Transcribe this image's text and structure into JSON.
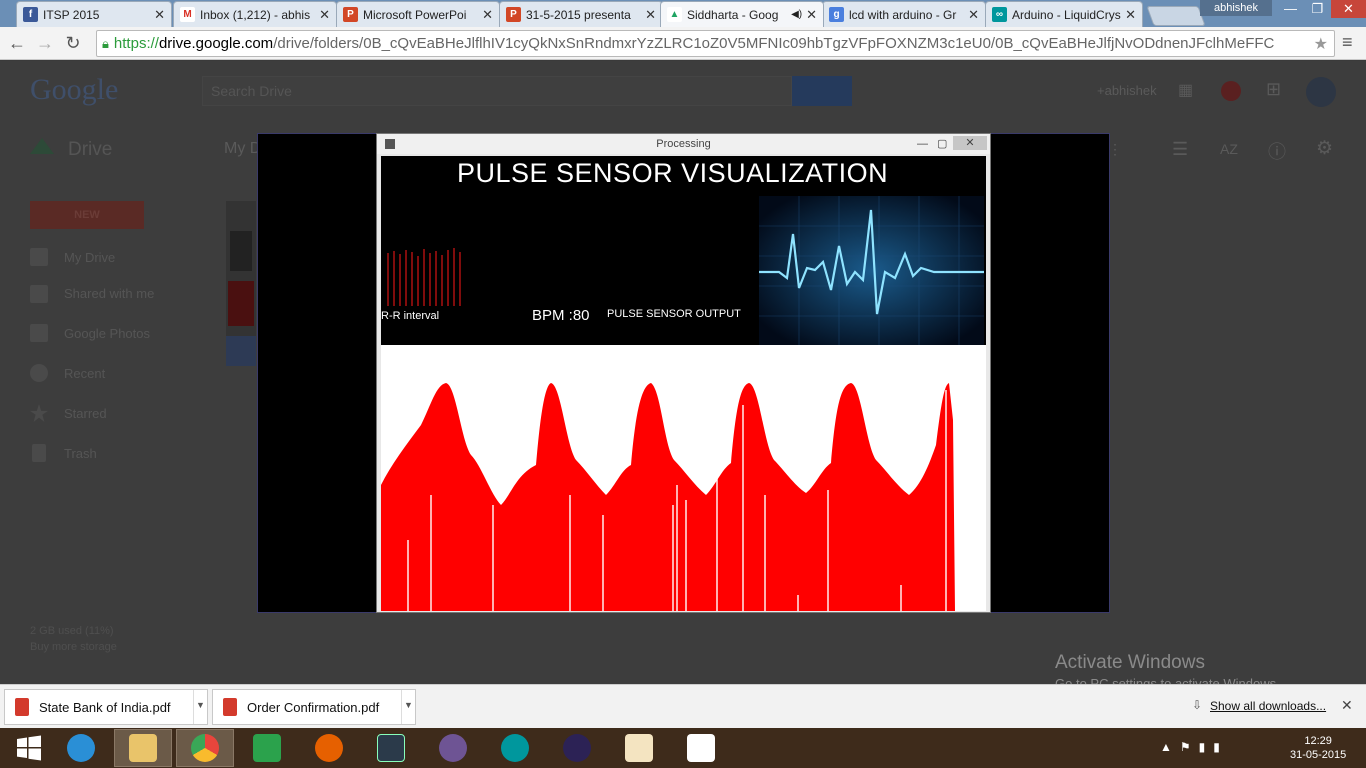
{
  "tabs": [
    {
      "label": "ITSP 2015",
      "icon": "facebook-icon",
      "color": "#3b5998",
      "glyph": "f"
    },
    {
      "label": "Inbox (1,212) - abhis",
      "icon": "gmail-icon",
      "color": "#d93025",
      "glyph": "M"
    },
    {
      "label": "Microsoft PowerPoi",
      "icon": "powerpoint-icon",
      "color": "#d24726",
      "glyph": "P"
    },
    {
      "label": "31-5-2015 presenta",
      "icon": "powerpoint-icon",
      "color": "#d24726",
      "glyph": "P"
    },
    {
      "label": "Siddharta - Goog",
      "icon": "drive-icon",
      "color": "#1fa463",
      "glyph": "▲"
    },
    {
      "label": "lcd with arduino - Gr",
      "icon": "google-search-icon",
      "color": "#4a7fde",
      "glyph": "g"
    },
    {
      "label": "Arduino - LiquidCrys",
      "icon": "arduino-icon",
      "color": "#00979d",
      "glyph": "∞"
    }
  ],
  "user_label": "abhishek",
  "window_controls": {
    "minimize": "—",
    "restore": "❐",
    "close": "✕"
  },
  "address": {
    "scheme": "https://",
    "domain": "drive.google.com",
    "path": "/drive/folders/0B_cQvEaBHeJlflhIV1cyQkNxSnRndmxrYzZLRC1oZ0V5MFNIc09hbTgzVFpFOXNZM3c1eU0/0B_cQvEaBHeJlfjNvODdnenJFclhMeFFC"
  },
  "drive": {
    "logo": "Google",
    "search_placeholder": "Search Drive",
    "user": "+abhishek",
    "title": "Drive",
    "breadcrumb": "My D",
    "new_button": "NEW",
    "sidebar": [
      "My Drive",
      "Shared with me",
      "Google Photos",
      "Recent",
      "Starred",
      "Trash"
    ],
    "quota_used": "2 GB used (11%)",
    "quota_buy": "Buy more storage"
  },
  "processing": {
    "window_title": "Processing",
    "heading": "PULSE SENSOR VISUALIZATION",
    "rr_label": "R-R interval",
    "bpm_label": "BPM :80",
    "output_label": "PULSE SENSOR OUTPUT",
    "colors": {
      "wave": "#ff0000",
      "background": "#000000",
      "plot_bg": "#ffffff",
      "ecg": "#4fc3ff"
    }
  },
  "activate_windows": {
    "title": "Activate Windows",
    "subtitle": "Go to PC settings to activate Windows."
  },
  "downloads": {
    "items": [
      "State Bank of India.pdf",
      "Order Confirmation.pdf"
    ],
    "show_all": "Show all downloads...",
    "close": "✕"
  },
  "taskbar": {
    "apps": [
      {
        "name": "start-button",
        "color": "#ffffff"
      },
      {
        "name": "internet-explorer-icon",
        "color": "#2a8fd6"
      },
      {
        "name": "file-explorer-icon",
        "color": "#e9c46a"
      },
      {
        "name": "chrome-icon",
        "color": "#e8453c"
      },
      {
        "name": "store-icon",
        "color": "#2ba24c"
      },
      {
        "name": "firefox-icon",
        "color": "#e66000"
      },
      {
        "name": "lightroom-icon",
        "color": "#2b3a4a"
      },
      {
        "name": "github-icon",
        "color": "#6e5494"
      },
      {
        "name": "arduino-icon",
        "color": "#00979d"
      },
      {
        "name": "eclipse-icon",
        "color": "#2c2255"
      },
      {
        "name": "fritzing-icon",
        "color": "#f4e4c1"
      },
      {
        "name": "eagle-icon",
        "color": "#ffffff"
      }
    ],
    "time": "12:29",
    "date": "31-05-2015"
  }
}
